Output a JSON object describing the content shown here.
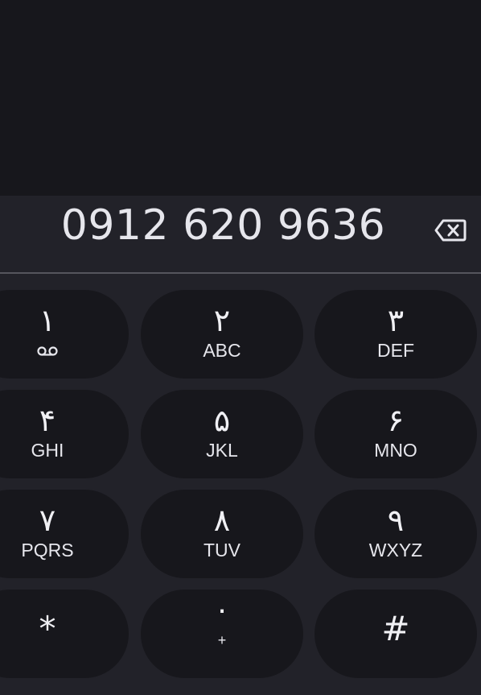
{
  "display": {
    "number": "0912 620 9636"
  },
  "icons": {
    "backspace": "backspace-icon",
    "voicemail": "voicemail-icon"
  },
  "keys": [
    {
      "digit": "١",
      "letters": ""
    },
    {
      "digit": "٢",
      "letters": "ABC"
    },
    {
      "digit": "٣",
      "letters": "DEF"
    },
    {
      "digit": "۴",
      "letters": "GHI"
    },
    {
      "digit": "۵",
      "letters": "JKL"
    },
    {
      "digit": "۶",
      "letters": "MNO"
    },
    {
      "digit": "٧",
      "letters": "PQRS"
    },
    {
      "digit": "٨",
      "letters": "TUV"
    },
    {
      "digit": "٩",
      "letters": "WXYZ"
    },
    {
      "digit": "*",
      "letters": ""
    },
    {
      "digit": "٠",
      "letters": "+"
    },
    {
      "digit": "#",
      "letters": ""
    }
  ],
  "colors": {
    "background": "#17171c",
    "keypad_background": "#222229",
    "key_background": "#17171c",
    "text": "#f0f0f4"
  }
}
